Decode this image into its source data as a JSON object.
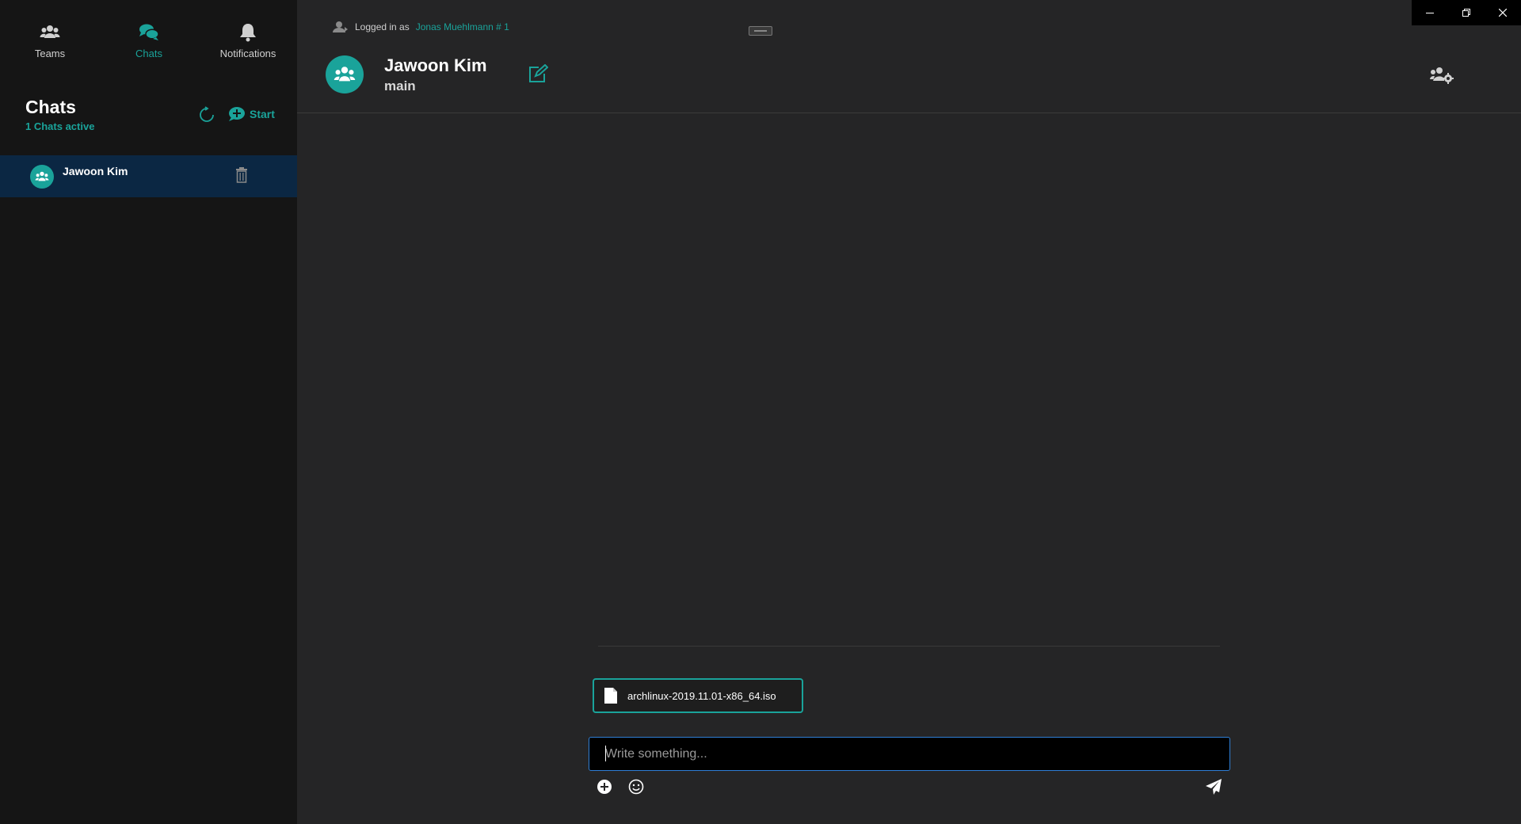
{
  "nav": {
    "teams_label": "Teams",
    "chats_label": "Chats",
    "notifications_label": "Notifications",
    "active": "chats"
  },
  "sidebar": {
    "title": "Chats",
    "subtitle": "1 Chats active",
    "start_label": "Start",
    "chats": [
      {
        "name": "Jawoon Kim",
        "icon": "group-icon",
        "selected": true
      }
    ]
  },
  "header": {
    "logged_in_prefix": "Logged in as",
    "logged_in_user": "Jonas Muehlmann # 1",
    "room_name": "Jawoon Kim",
    "room_channel": "main"
  },
  "composer": {
    "attachment_name": "archlinux-2019.11.01-x86_64.iso",
    "placeholder": "Write something..."
  },
  "colors": {
    "accent": "#1aa39a",
    "selected_bg": "#0b2743",
    "sidebar_bg": "#151515",
    "main_bg": "#252526",
    "input_border": "#2f7fd6"
  }
}
